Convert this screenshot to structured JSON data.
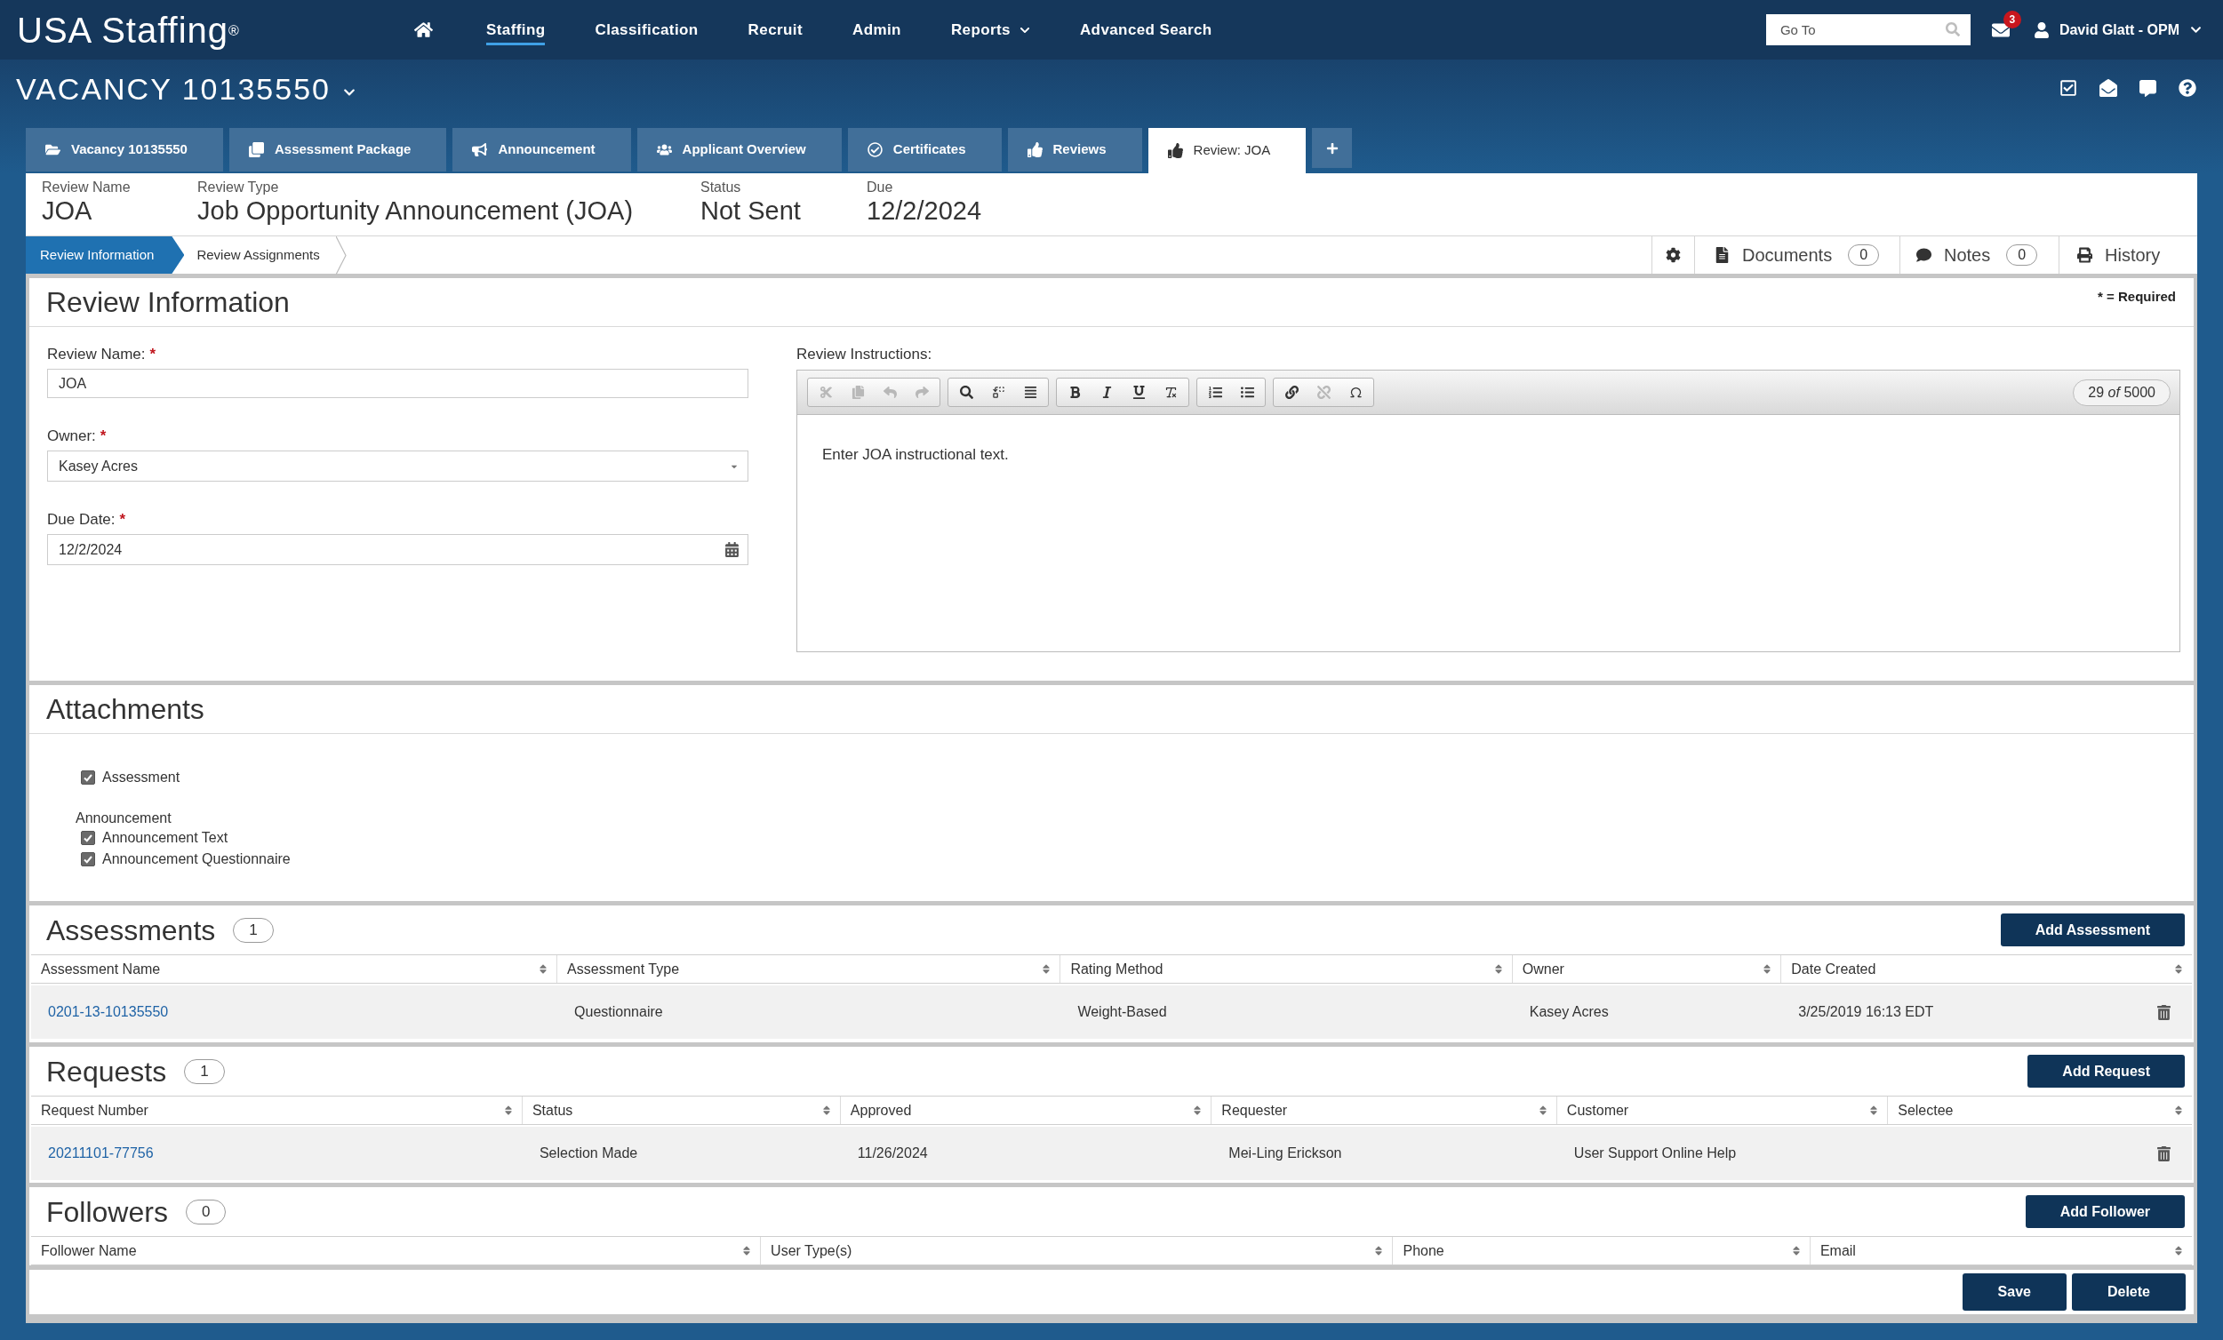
{
  "top_nav": {
    "logo": "USA Staffing$^{®}$",
    "items": [
      {
        "label": "Staffing",
        "kind": "link",
        "selected": true
      },
      {
        "label": "Classification",
        "kind": "link",
        "selected": false
      },
      {
        "label": "Recruit",
        "kind": "link",
        "selected": false
      },
      {
        "label": "Admin",
        "kind": "link",
        "selected": false
      },
      {
        "label": "Reports",
        "kind": "menu",
        "selected": false
      },
      {
        "label": "Advanced Search",
        "kind": "link",
        "selected": false
      }
    ],
    "go_to": {
      "placeholder": "Go To"
    },
    "messages_count": "3",
    "user_name": "David Glatt - OPM"
  },
  "vacancy": {
    "title": "VACANCY 10135550"
  },
  "tabs": [
    {
      "label": "Vacancy 10135550",
      "selected": false
    },
    {
      "label": "Assessment Package",
      "selected": false
    },
    {
      "label": "Announcement",
      "selected": false
    },
    {
      "label": "Applicant Overview",
      "selected": false
    },
    {
      "label": "Certificates",
      "selected": false
    },
    {
      "label": "Reviews",
      "selected": false
    },
    {
      "label": "Review: JOA",
      "selected": true
    }
  ],
  "review_header": {
    "fields": [
      {
        "label": "Review Name",
        "value": "JOA"
      },
      {
        "label": "Review Type",
        "value": "Job Opportunity Announcement (JOA)"
      },
      {
        "label": "Status",
        "value": "Not Sent"
      },
      {
        "label": "Due",
        "value": "12/2/2024"
      }
    ]
  },
  "subtabs": [
    {
      "label": "Review Information",
      "selected": true
    },
    {
      "label": "Review Assignments",
      "selected": false
    }
  ],
  "side_actions": [
    {
      "kind": "settings"
    },
    {
      "kind": "documents",
      "label": "Documents",
      "count": "0"
    },
    {
      "kind": "notes",
      "label": "Notes",
      "count": "0"
    },
    {
      "kind": "history",
      "label": "History"
    }
  ],
  "review_information": {
    "title": "Review Information",
    "required_note": "* = Required",
    "fields": [
      {
        "kind": "text",
        "label": "Review Name:",
        "required_mark": "*",
        "value": "JOA"
      },
      {
        "kind": "select",
        "label": "Owner:",
        "required_mark": "*",
        "value": "Kasey Acres"
      },
      {
        "kind": "date",
        "label": "Due Date:",
        "required_mark": "*",
        "value": "12/2/2024"
      }
    ],
    "instructions": {
      "label": "Review Instructions:",
      "counter": "29 *of* 5000",
      "text": "Enter JOA instructional text.",
      "toolbar": [
        {
          "buttons": [
            {
              "kind": "cut",
              "disabled": true
            },
            {
              "kind": "copy",
              "disabled": true
            },
            {
              "kind": "undo",
              "disabled": true
            },
            {
              "kind": "redo",
              "disabled": true
            }
          ]
        },
        {
          "buttons": [
            {
              "kind": "find",
              "disabled": false
            },
            {
              "kind": "replace",
              "disabled": false
            },
            {
              "kind": "select_all",
              "disabled": false
            }
          ]
        },
        {
          "buttons": [
            {
              "kind": "bold",
              "disabled": false
            },
            {
              "kind": "italic",
              "disabled": false
            },
            {
              "kind": "underline",
              "disabled": false
            },
            {
              "kind": "clear_format",
              "disabled": false
            }
          ]
        },
        {
          "buttons": [
            {
              "kind": "numbered_list",
              "disabled": false
            },
            {
              "kind": "bulleted_list",
              "disabled": false
            }
          ]
        },
        {
          "buttons": [
            {
              "kind": "link",
              "disabled": false
            },
            {
              "kind": "unlink",
              "disabled": true
            },
            {
              "kind": "special_char",
              "disabled": false
            }
          ]
        }
      ]
    }
  },
  "attachments": {
    "title": "Attachments",
    "items": [
      {
        "kind": "checkbox",
        "label": "Assessment",
        "checked": true
      },
      {
        "kind": "group",
        "label": "Announcement",
        "children": [
          {
            "kind": "checkbox",
            "label": "Announcement Text",
            "checked": true
          },
          {
            "kind": "checkbox",
            "label": "Announcement Questionnaire",
            "checked": true
          }
        ]
      }
    ]
  },
  "assessments": {
    "title": "Assessments",
    "count": "1",
    "add_button": "Add Assessment",
    "columns": [
      "Assessment Name",
      "Assessment Type",
      "Rating Method",
      "Owner",
      "Date Created"
    ],
    "rows": [
      {
        "cells": [
          "0201-13-10135550",
          "Questionnaire",
          "Weight-Based",
          "Kasey Acres",
          "3/25/2019 16:13 EDT"
        ]
      }
    ]
  },
  "requests": {
    "title": "Requests",
    "count": "1",
    "add_button": "Add Request",
    "columns": [
      "Request Number",
      "Status",
      "Approved",
      "Requester",
      "Customer",
      "Selectee"
    ],
    "rows": [
      {
        "cells": [
          "20211101-77756",
          "Selection Made",
          "11/26/2024",
          "Mei-Ling Erickson",
          "User Support Online Help"
        ]
      }
    ]
  },
  "followers": {
    "title": "Followers",
    "count": "0",
    "add_button": "Add Follower",
    "columns": [
      "Follower Name",
      "User Type(s)",
      "Phone",
      "Email"
    ]
  },
  "footer_buttons": [
    {
      "label": "Save"
    },
    {
      "label": "Delete"
    }
  ]
}
